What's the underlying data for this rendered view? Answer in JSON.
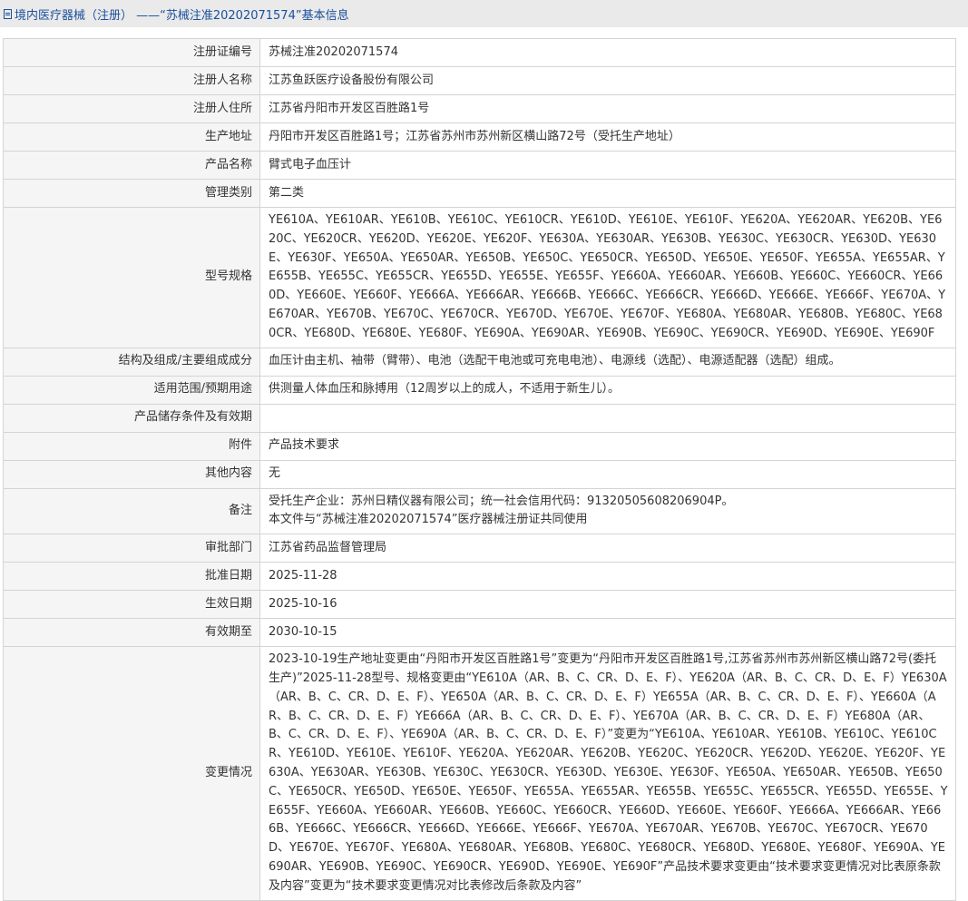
{
  "header": {
    "title": "境内医疗器械（注册）  ——“苏械注准20202071574”基本信息"
  },
  "rows": [
    {
      "key": "reg_no",
      "label": "注册证编号",
      "value": "苏械注准20202071574"
    },
    {
      "key": "registrant",
      "label": "注册人名称",
      "value": "江苏鱼跃医疗设备股份有限公司"
    },
    {
      "key": "residence",
      "label": "注册人住所",
      "value": "江苏省丹阳市开发区百胜路1号"
    },
    {
      "key": "prod_addr",
      "label": "生产地址",
      "value": "丹阳市开发区百胜路1号；江苏省苏州市苏州新区横山路72号（受托生产地址）"
    },
    {
      "key": "prod_name",
      "label": "产品名称",
      "value": "臂式电子血压计"
    },
    {
      "key": "category",
      "label": "管理类别",
      "value": "第二类"
    },
    {
      "key": "models",
      "label": "型号规格",
      "value": "YE610A、YE610AR、YE610B、YE610C、YE610CR、YE610D、YE610E、YE610F、YE620A、YE620AR、YE620B、YE620C、YE620CR、YE620D、YE620E、YE620F、YE630A、YE630AR、YE630B、YE630C、YE630CR、YE630D、YE630E、YE630F、YE650A、YE650AR、YE650B、YE650C、YE650CR、YE650D、YE650E、YE650F、YE655A、YE655AR、YE655B、YE655C、YE655CR、YE655D、YE655E、YE655F、YE660A、YE660AR、YE660B、YE660C、YE660CR、YE660D、YE660E、YE660F、YE666A、YE666AR、YE666B、YE666C、YE666CR、YE666D、YE666E、YE666F、YE670A、YE670AR、YE670B、YE670C、YE670CR、YE670D、YE670E、YE670F、YE680A、YE680AR、YE680B、YE680C、YE680CR、YE680D、YE680E、YE680F、YE690A、YE690AR、YE690B、YE690C、YE690CR、YE690D、YE690E、YE690F"
    },
    {
      "key": "structure",
      "label": "结构及组成/主要组成成分",
      "value": "血压计由主机、袖带（臂带）、电池（选配干电池或可充电电池）、电源线（选配）、电源适配器（选配）组成。"
    },
    {
      "key": "usage",
      "label": "适用范围/预期用途",
      "value": "供测量人体血压和脉搏用（12周岁以上的成人，不适用于新生儿）。"
    },
    {
      "key": "storage",
      "label": "产品储存条件及有效期",
      "value": ""
    },
    {
      "key": "attachment",
      "label": "附件",
      "value": "产品技术要求"
    },
    {
      "key": "other",
      "label": "其他内容",
      "value": "无"
    },
    {
      "key": "remark",
      "label": "备注",
      "value": "受托生产企业：苏州日精仪器有限公司；统一社会信用代码：91320505608206904P。\n本文件与“苏械注准20202071574”医疗器械注册证共同使用"
    },
    {
      "key": "dept",
      "label": "审批部门",
      "value": "江苏省药品监督管理局"
    },
    {
      "key": "approve_date",
      "label": "批准日期",
      "value": "2025-11-28"
    },
    {
      "key": "effective_date",
      "label": "生效日期",
      "value": "2025-10-16"
    },
    {
      "key": "expiry",
      "label": "有效期至",
      "value": "2030-10-15"
    },
    {
      "key": "changes",
      "label": "变更情况",
      "value": "2023-10-19生产地址变更由“丹阳市开发区百胜路1号”变更为“丹阳市开发区百胜路1号,江苏省苏州市苏州新区横山路72号(委托生产)”2025-11-28型号、规格变更由“YE610A（AR、B、C、CR、D、E、F）、YE620A（AR、B、C、CR、D、E、F）YE630A（AR、B、C、CR、D、E、F）、YE650A（AR、B、C、CR、D、E、F）YE655A（AR、B、C、CR、D、E、F）、YE660A（AR、B、C、CR、D、E、F）YE666A（AR、B、C、CR、D、E、F）、YE670A（AR、B、C、CR、D、E、F）YE680A（AR、B、C、CR、D、E、F）、YE690A（AR、B、C、CR、D、E、F）”变更为“YE610A、YE610AR、YE610B、YE610C、YE610CR、YE610D、YE610E、YE610F、YE620A、YE620AR、YE620B、YE620C、YE620CR、YE620D、YE620E、YE620F、YE630A、YE630AR、YE630B、YE630C、YE630CR、YE630D、YE630E、YE630F、YE650A、YE650AR、YE650B、YE650C、YE650CR、YE650D、YE650E、YE650F、YE655A、YE655AR、YE655B、YE655C、YE655CR、YE655D、YE655E、YE655F、YE660A、YE660AR、YE660B、YE660C、YE660CR、YE660D、YE660E、YE660F、YE666A、YE666AR、YE666B、YE666C、YE666CR、YE666D、YE666E、YE666F、YE670A、YE670AR、YE670B、YE670C、YE670CR、YE670D、YE670E、YE670F、YE680A、YE680AR、YE680B、YE680C、YE680CR、YE680D、YE680E、YE680F、YE690A、YE690AR、YE690B、YE690C、YE690CR、YE690D、YE690E、YE690F”产品技术要求变更由“技术要求变更情况对比表原条款及内容”变更为“技术要求变更情况对比表修改后条款及内容”"
    }
  ]
}
